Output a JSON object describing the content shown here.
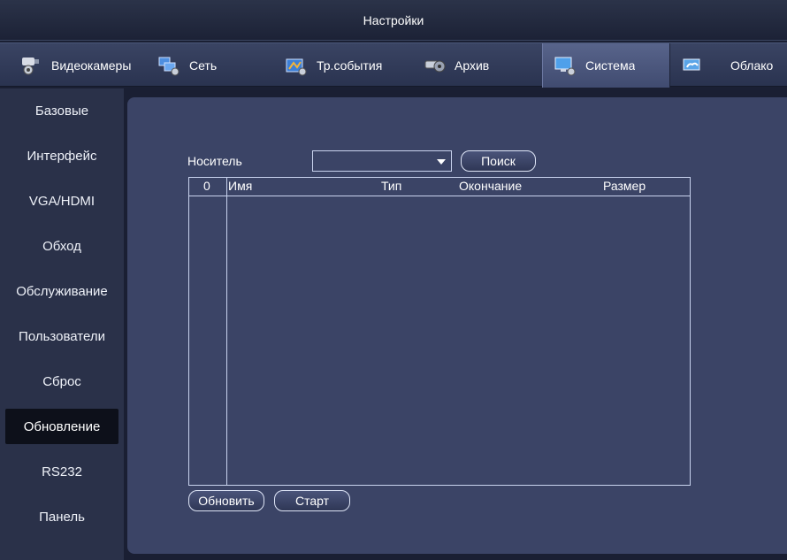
{
  "window": {
    "title": "Настройки"
  },
  "tabs": [
    {
      "label": "Видеокамеры",
      "icon": "camera-icon",
      "active": false
    },
    {
      "label": "Сеть",
      "icon": "network-icon",
      "active": false
    },
    {
      "label": "Тр.события",
      "icon": "alarm-events-icon",
      "active": false
    },
    {
      "label": "Архив",
      "icon": "storage-icon",
      "active": false
    },
    {
      "label": "Система",
      "icon": "system-icon",
      "active": true
    },
    {
      "label": "Облако",
      "icon": "cloud-icon",
      "active": false
    }
  ],
  "sidebar": {
    "items": [
      {
        "label": "Базовые"
      },
      {
        "label": "Интерфейс"
      },
      {
        "label": "VGA/HDMI"
      },
      {
        "label": "Обход"
      },
      {
        "label": "Обслуживание"
      },
      {
        "label": "Пользователи"
      },
      {
        "label": "Сброс"
      },
      {
        "label": "Обновление",
        "active": true
      },
      {
        "label": "RS232"
      },
      {
        "label": "Панель"
      }
    ]
  },
  "upgrade": {
    "device_label": "Носитель",
    "device_value": "",
    "search_button": "Поиск",
    "table": {
      "columns": [
        "0",
        "Имя",
        "Тип",
        "Окончание",
        "Размер"
      ],
      "rows": []
    },
    "refresh_button": "Обновить",
    "start_button": "Старт"
  },
  "colors": {
    "background": "#1a1f33",
    "panel": "#3b4466",
    "sidebar": "#2a3149",
    "active_item": "#0d101a"
  }
}
